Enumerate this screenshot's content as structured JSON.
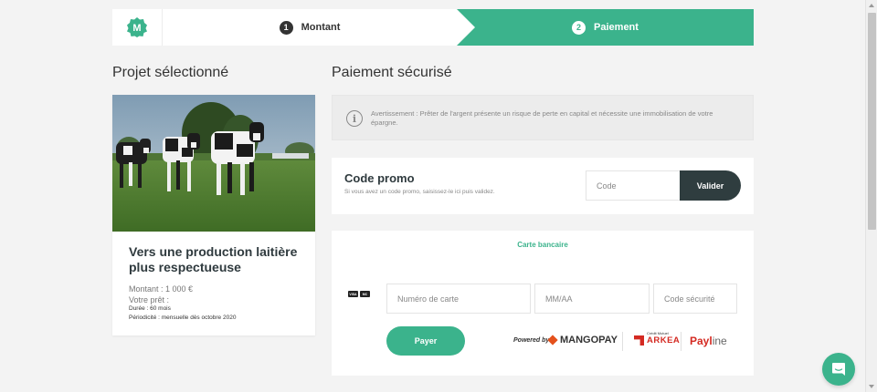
{
  "colors": {
    "accent": "#3bb38c",
    "dark": "#2f3d3f",
    "background": "#f3f3f3"
  },
  "logo": {
    "letter": "M",
    "icon": "company-logo-icon"
  },
  "stepper": {
    "steps": [
      {
        "number": "1",
        "label": "Montant"
      },
      {
        "number": "2",
        "label": "Paiement"
      }
    ]
  },
  "left": {
    "heading": "Projet sélectionné",
    "project": {
      "image": "cows-in-pasture-photo",
      "title": "Vers une production laitière plus respectueuse",
      "amount": "Montant : 1 000 €",
      "loan_label": "Votre prêt :",
      "duration": "Durée : 60 mois",
      "periodicity": "Périodicité : mensuelle dès octobre 2020"
    }
  },
  "right": {
    "heading": "Paiement sécurisé",
    "warning": {
      "icon": "info-icon",
      "text": "Avertissement : Prêter de l'argent présente un risque de perte en capital et nécessite une immobilisation de votre épargne."
    },
    "promo": {
      "title": "Code promo",
      "hint": "Si vous avez un code promo, saisissez-le ici puis validez.",
      "placeholder": "Code",
      "button": "Valider"
    },
    "card": {
      "tab": "Carte bancaire",
      "logos": [
        "VISA",
        "MC"
      ],
      "number_placeholder": "Numéro de carte",
      "expiry_placeholder": "MM/AA",
      "cvc_placeholder": "Code sécurité",
      "pay_button": "Payer",
      "powered_by": "Powered by",
      "mangopay": "MANGOPAY",
      "arkea_small": "Crédit Mutuel",
      "arkea": "ARKEA",
      "payline_main": "Payl",
      "payline_end": "ine"
    }
  },
  "chat": {
    "icon": "chat-icon"
  }
}
